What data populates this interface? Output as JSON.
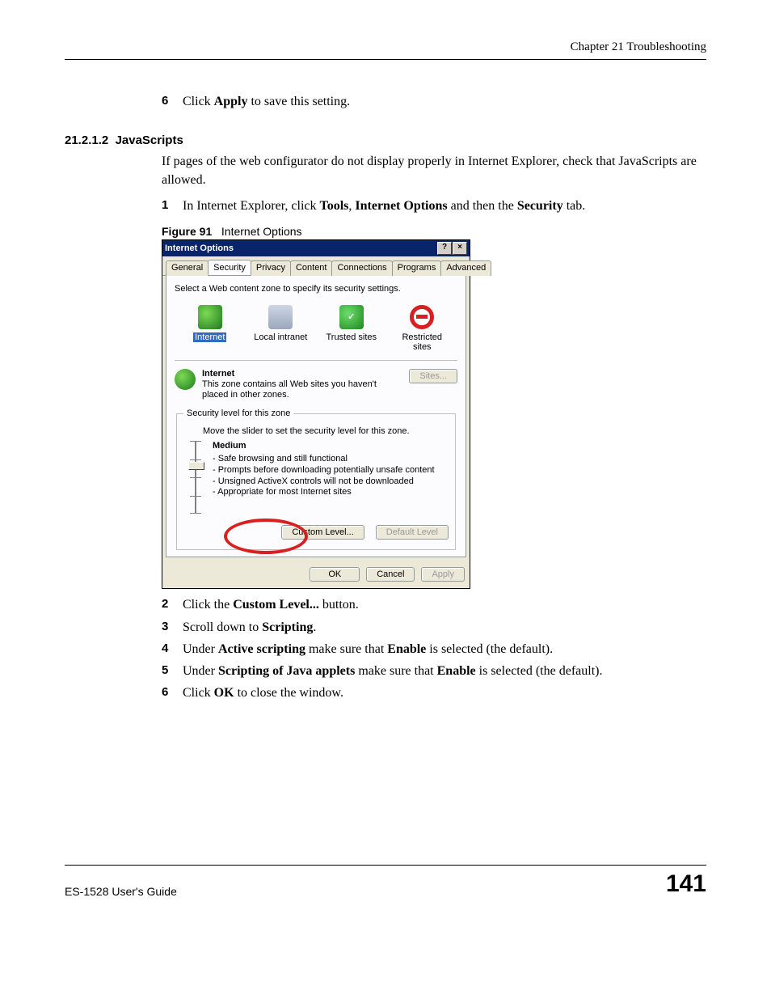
{
  "header": {
    "chapter": "Chapter 21 Troubleshooting"
  },
  "pre_steps": [
    {
      "n": "6",
      "html": "Click <b>Apply</b> to save this setting."
    }
  ],
  "section": {
    "number": "21.2.1.2",
    "title": "JavaScripts",
    "intro": "If pages of the web configurator do not display properly in Internet Explorer, check that JavaScripts are allowed.",
    "steps_a": [
      {
        "n": "1",
        "html": "In Internet Explorer, click <b>Tools</b>, <b>Internet Options</b> and then the <b>Security</b> tab."
      }
    ],
    "figure": {
      "label": "Figure 91",
      "caption": "Internet Options"
    },
    "steps_b": [
      {
        "n": "2",
        "html": "Click the <b>Custom Level...</b> button."
      },
      {
        "n": "3",
        "html": "Scroll down to <b>Scripting</b>."
      },
      {
        "n": "4",
        "html": "Under <b>Active scripting</b> make sure that <b>Enable</b> is selected (the default)."
      },
      {
        "n": "5",
        "html": "Under <b>Scripting of Java applets</b> make sure that <b>Enable</b> is selected (the default)."
      },
      {
        "n": "6",
        "html": "Click <b>OK</b> to close the window."
      }
    ]
  },
  "dialog": {
    "title": "Internet Options",
    "help_btn": "?",
    "close_btn": "×",
    "tabs": [
      "General",
      "Security",
      "Privacy",
      "Content",
      "Connections",
      "Programs",
      "Advanced"
    ],
    "active_tab": 1,
    "zone_hint": "Select a Web content zone to specify its security settings.",
    "zones": [
      {
        "label": "Internet",
        "selected": true
      },
      {
        "label": "Local intranet",
        "selected": false
      },
      {
        "label": "Trusted sites",
        "selected": false
      },
      {
        "label": "Restricted sites",
        "selected": false
      }
    ],
    "zone_title": "Internet",
    "zone_desc": "This zone contains all Web sites you haven't placed in other zones.",
    "sites_btn": "Sites...",
    "sec_legend": "Security level for this zone",
    "slider_hint": "Move the slider to set the security level for this zone.",
    "level_name": "Medium",
    "level_bullets": [
      "- Safe browsing and still functional",
      "- Prompts before downloading potentially unsafe content",
      "- Unsigned ActiveX controls will not be downloaded",
      "- Appropriate for most Internet sites"
    ],
    "custom_btn": "Custom Level...",
    "default_btn": "Default Level",
    "ok_btn": "OK",
    "cancel_btn": "Cancel",
    "apply_btn": "Apply"
  },
  "footer": {
    "guide": "ES-1528 User's Guide",
    "page": "141"
  }
}
